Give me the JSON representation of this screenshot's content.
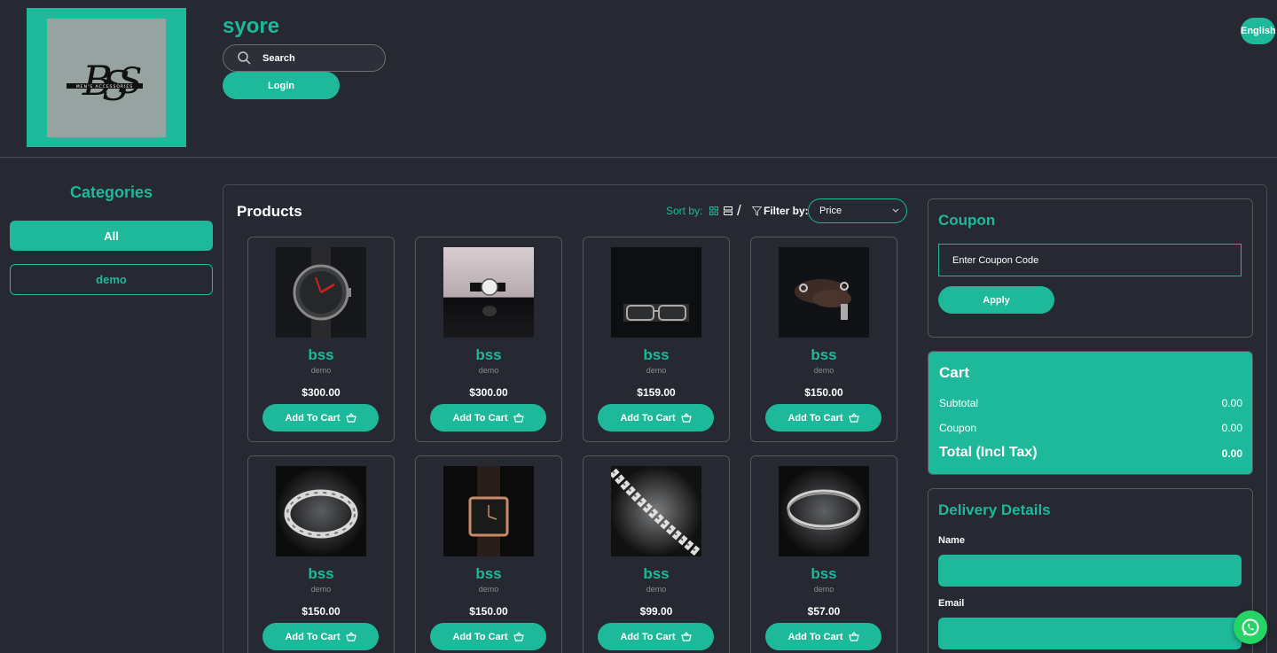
{
  "header": {
    "store_name": "syore",
    "logo_text": "BSS",
    "logo_tagline": "MEN'S ACCESSORIES",
    "search_placeholder": "Search",
    "login_label": "Login",
    "language_label": "English"
  },
  "categories": {
    "title": "Categories",
    "items": [
      {
        "label": "All",
        "active": true
      },
      {
        "label": "demo",
        "active": false
      }
    ]
  },
  "products_section": {
    "title": "Products",
    "sort_label": "Sort by:",
    "filter_label": "Filter by:",
    "filter_selected": "Price",
    "items": [
      {
        "name": "bss",
        "category": "demo",
        "price": "$300.00",
        "cta": "Add To Cart",
        "image": "watch-dark-red-hands"
      },
      {
        "name": "bss",
        "category": "demo",
        "price": "$300.00",
        "cta": "Add To Cart",
        "image": "watch-white-dial-reflection"
      },
      {
        "name": "bss",
        "category": "demo",
        "price": "$159.00",
        "cta": "Add To Cart",
        "image": "eyeglasses"
      },
      {
        "name": "bss",
        "category": "demo",
        "price": "$150.00",
        "cta": "Add To Cart",
        "image": "hands-with-rings"
      },
      {
        "name": "bss",
        "category": "demo",
        "price": "$150.00",
        "cta": "Add To Cart",
        "image": "silver-bracelet"
      },
      {
        "name": "bss",
        "category": "demo",
        "price": "$150.00",
        "cta": "Add To Cart",
        "image": "rose-gold-square-watch"
      },
      {
        "name": "bss",
        "category": "demo",
        "price": "$99.00",
        "cta": "Add To Cart",
        "image": "silver-chain"
      },
      {
        "name": "bss",
        "category": "demo",
        "price": "$57.00",
        "cta": "Add To Cart",
        "image": "thin-silver-bracelet"
      }
    ]
  },
  "coupon": {
    "title": "Coupon",
    "placeholder": "Enter Coupon Code",
    "apply_label": "Apply"
  },
  "cart": {
    "title": "Cart",
    "subtotal_label": "Subtotal",
    "subtotal_value": "0.00",
    "coupon_label": "Coupon",
    "coupon_value": "0.00",
    "total_label": "Total (Incl Tax)",
    "total_value": "0.00"
  },
  "delivery": {
    "title": "Delivery Details",
    "name_label": "Name",
    "email_label": "Email"
  },
  "colors": {
    "accent": "#1db99a",
    "background": "#262832",
    "whatsapp": "#25d366"
  },
  "icons": [
    "search-icon",
    "grid-view-icon",
    "list-view-icon",
    "filter-icon",
    "chevron-down-icon",
    "basket-icon",
    "whatsapp-icon"
  ]
}
